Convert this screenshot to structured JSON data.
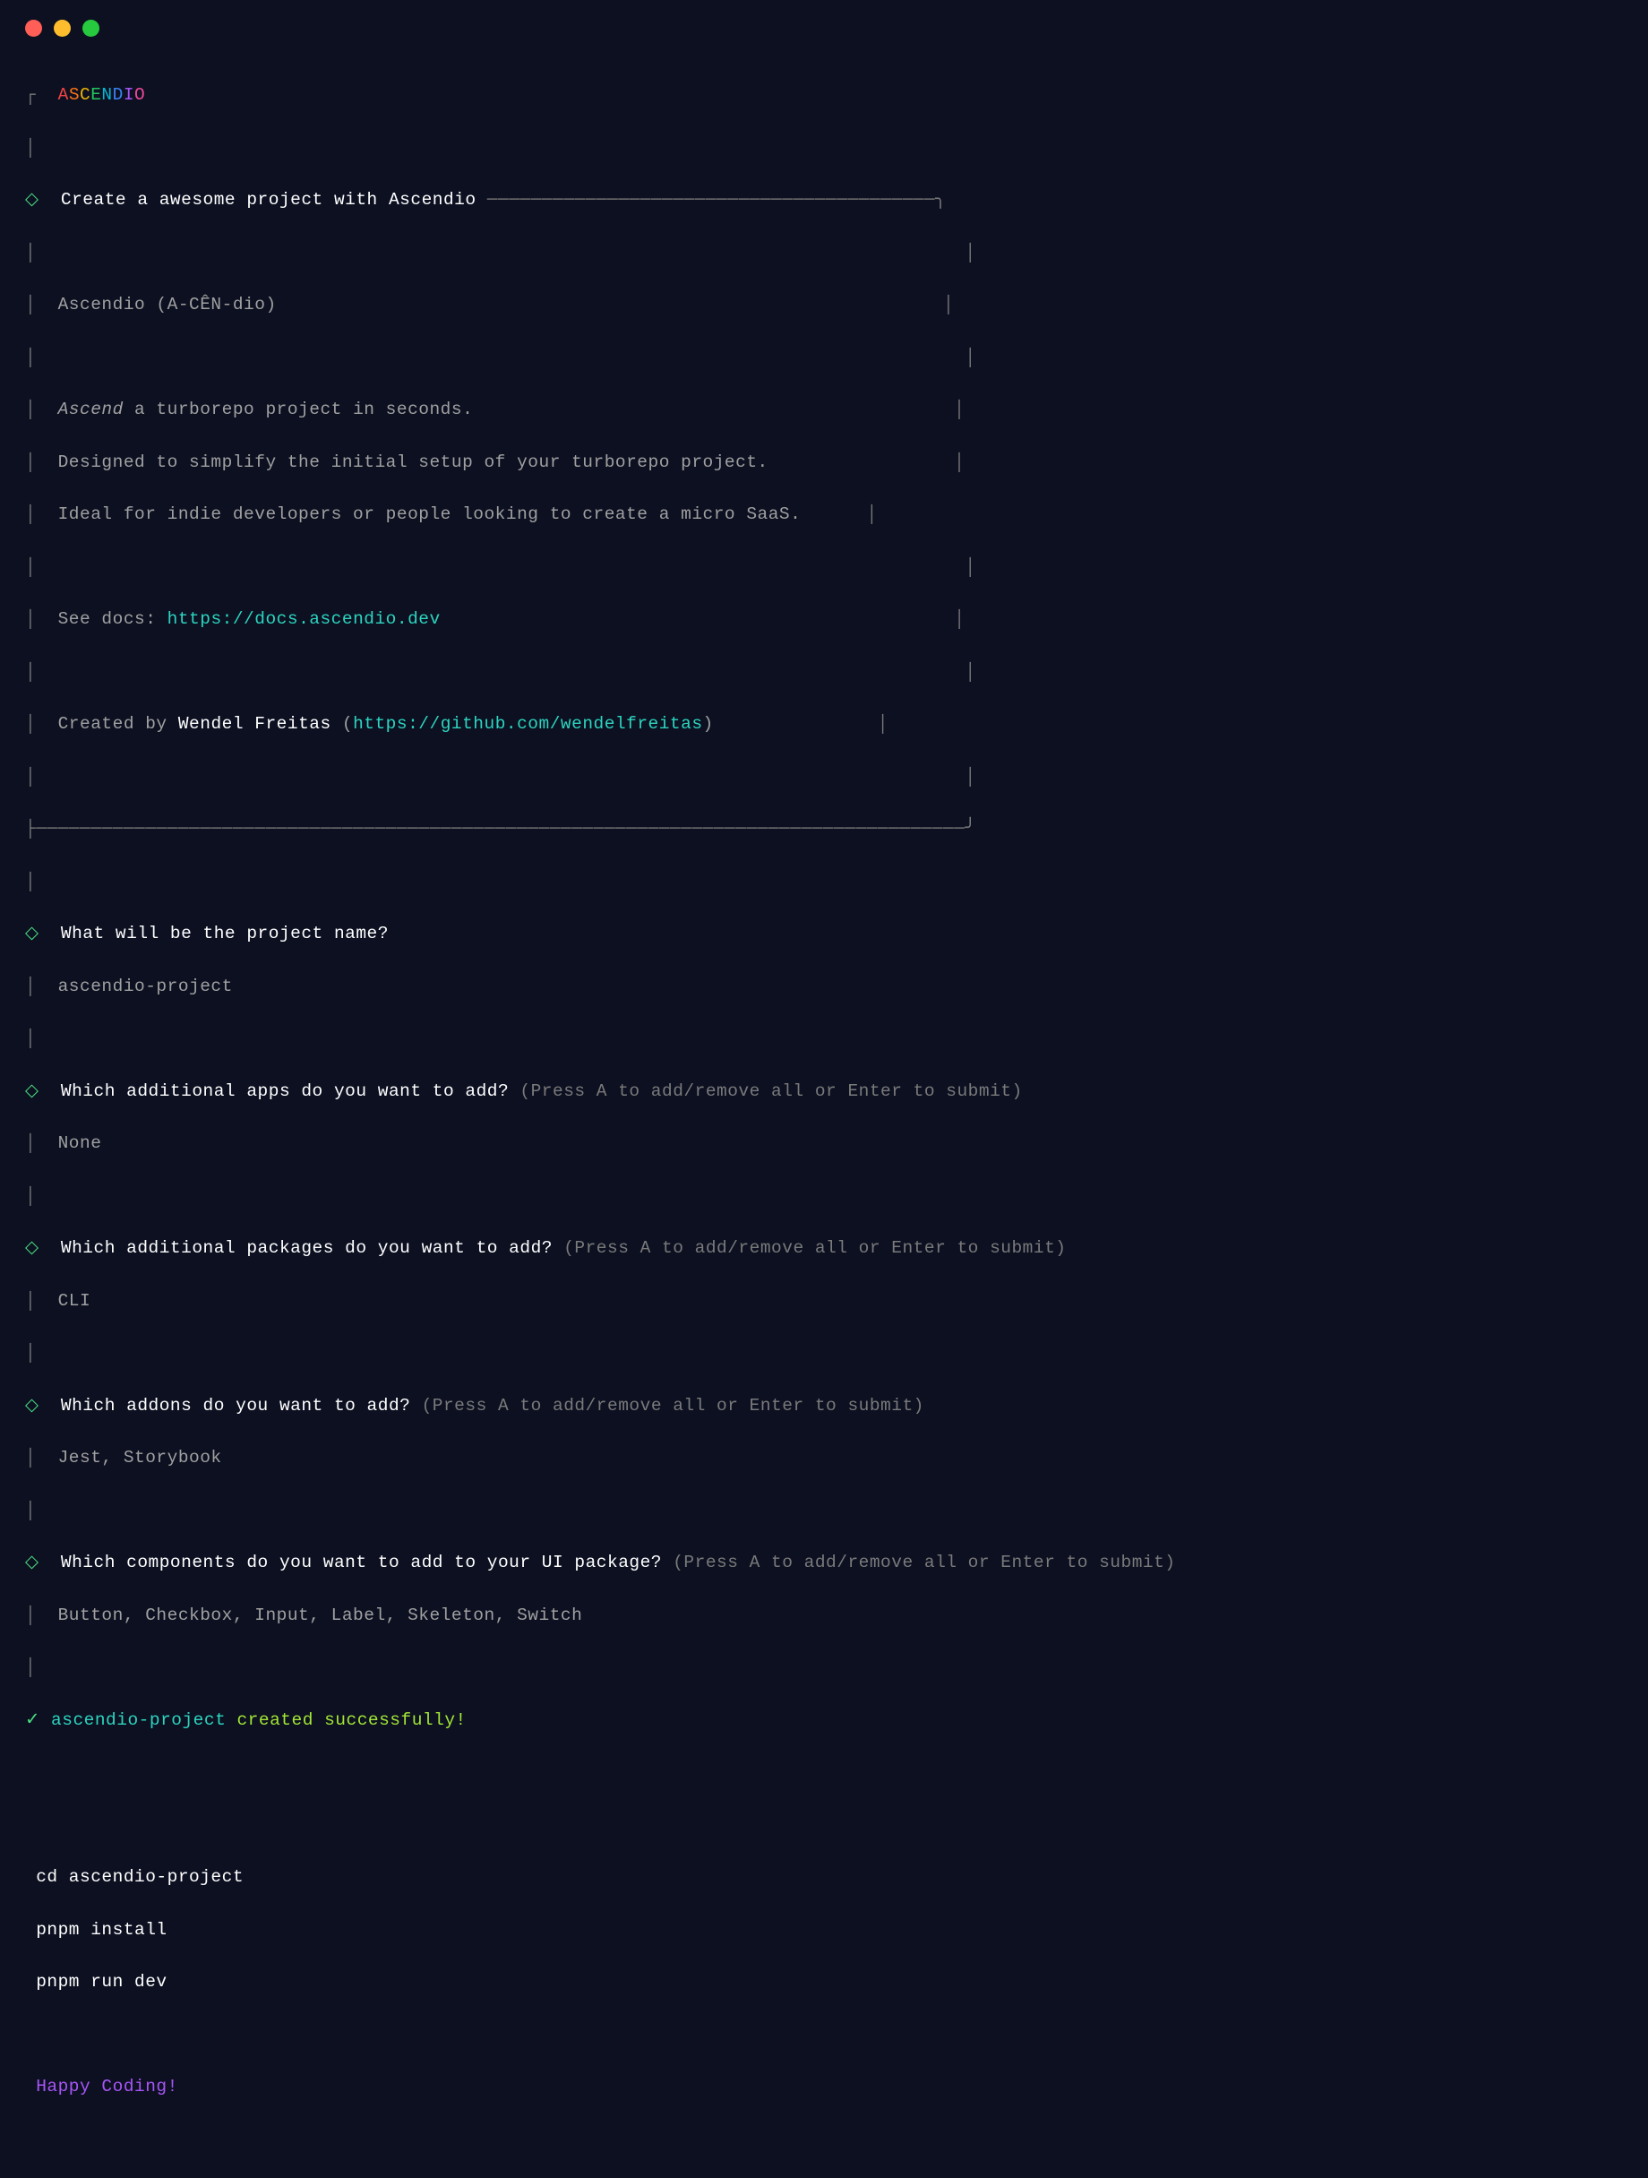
{
  "logo": {
    "letters": [
      {
        "ch": "A",
        "class": "c-red"
      },
      {
        "ch": "S",
        "class": "c-orange"
      },
      {
        "ch": "C",
        "class": "c-yellow"
      },
      {
        "ch": "E",
        "class": "c-green"
      },
      {
        "ch": "N",
        "class": "c-cyan"
      },
      {
        "ch": "D",
        "class": "c-blue"
      },
      {
        "ch": "I",
        "class": "c-purple"
      },
      {
        "ch": "O",
        "class": "c-pink"
      }
    ]
  },
  "header": {
    "title": "Create a awesome project with Ascendio",
    "pronunciation": "Ascendio (A-CÊN-dio)",
    "desc_line1_italic": "Ascend",
    "desc_line1_rest": " a turborepo project in seconds.",
    "desc_line2": "Designed to simplify the initial setup of your turborepo project.",
    "desc_line3": "Ideal for indie developers or people looking to create a micro SaaS.",
    "docs_label": "See docs: ",
    "docs_url": "https://docs.ascendio.dev",
    "created_by_label": "Created by ",
    "author": "Wendel Freitas",
    "author_paren_open": " (",
    "author_url": "https://github.com/wendelfreitas",
    "author_paren_close": ")"
  },
  "prompts": [
    {
      "question": "What will be the project name?",
      "hint": "",
      "answer": "ascendio-project"
    },
    {
      "question": "Which additional apps do you want to add?",
      "hint": " (Press A to add/remove all or Enter to submit)",
      "answer": "None"
    },
    {
      "question": "Which additional packages do you want to add?",
      "hint": " (Press A to add/remove all or Enter to submit)",
      "answer": "CLI"
    },
    {
      "question": "Which addons do you want to add?",
      "hint": " (Press A to add/remove all or Enter to submit)",
      "answer": "Jest, Storybook"
    },
    {
      "question": "Which components do you want to add to your UI package?",
      "hint": " (Press A to add/remove all or Enter to submit)",
      "answer": "Button, Checkbox, Input, Label, Skeleton, Switch"
    }
  ],
  "success": {
    "check": "✓",
    "project": "ascendio-project",
    "message": " created successfully!"
  },
  "commands": {
    "cd": " cd ascendio-project",
    "install": " pnpm install",
    "dev": " pnpm run dev"
  },
  "footer": " Happy Coding!",
  "box_chars": {
    "corner_tl": "┌",
    "pipe": "│",
    "diamond": "◇",
    "hline_segment": "─────────────────────────────────────────",
    "corner_close": "┐",
    "bottom_close": "└────────────────────────────────────────────────────────────────────────────────────┘"
  }
}
